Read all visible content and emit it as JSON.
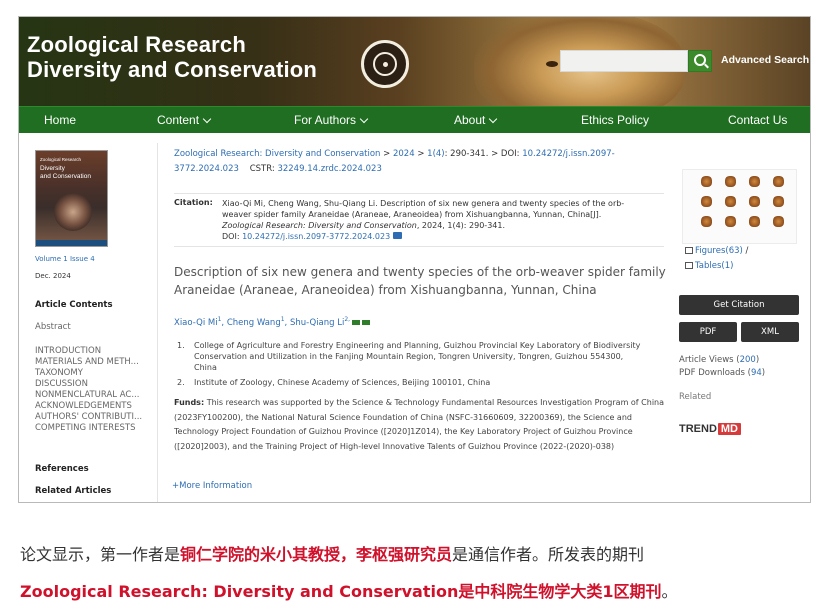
{
  "header": {
    "title_line1": "Zoological Research",
    "title_line2": "Diversity and Conservation",
    "search_placeholder": "",
    "advanced_search": "Advanced Search"
  },
  "nav": {
    "items": [
      "Home",
      "Content",
      "For Authors",
      "About",
      "Ethics Policy",
      "Contact Us"
    ]
  },
  "sidebar": {
    "cover_top": "Zoological Research",
    "cover_title1": "Diversity",
    "cover_title2": "and Conservation",
    "volume_issue": "Volume 1 Issue 4",
    "date": "Dec. 2024",
    "article_contents": "Article Contents",
    "abstract": "Abstract",
    "sections": [
      "INTRODUCTION",
      "MATERIALS AND METH...",
      "TAXONOMY",
      "DISCUSSION",
      "NONMENCLATURAL AC...",
      "ACKNOWLEDGEMENTS",
      "AUTHORS' CONTRIBUTI...",
      "COMPETING INTERESTS"
    ],
    "references": "References",
    "related_articles": "Related Articles"
  },
  "breadcrumb": {
    "journal": "Zoological Research: Diversity and Conservation",
    "sep1": " > ",
    "year": "2024",
    "sep2": " > ",
    "issue": "1(4)",
    "pages": ": 290-341. > DOI: ",
    "doi_part1": "10.24272/j.issn.2097-",
    "doi_part2": "3772.2024.023",
    "cstr_label": "CSTR: ",
    "cstr": "32249.14.zrdc.2024.023"
  },
  "citation": {
    "label": "Citation:",
    "line1": "Xiao-Qi Mi, Cheng Wang, Shu-Qiang Li. Description of six new genera and twenty species of the orb-",
    "line2": "weaver spider family Araneidae (Araneae, Araneoidea) from Xishuangbanna, Yunnan, China[J].",
    "line3_journal": "Zoological Research: Diversity and Conservation",
    "line3_rest": ", 2024, 1(4): 290-341.",
    "doi_label": "DOI: ",
    "doi": "10.24272/j.issn.2097-3772.2024.023"
  },
  "article": {
    "title_line1": "Description of six new genera and twenty species of the orb-weaver spider family",
    "title_line2": "Araneidae (Araneae, Araneoidea) from Xishuangbanna, Yunnan, China",
    "authors": [
      {
        "name": "Xiao-Qi Mi",
        "sup": "1"
      },
      {
        "name": "Cheng Wang",
        "sup": "1"
      },
      {
        "name": "Shu-Qiang Li",
        "sup": "2,"
      }
    ],
    "affiliations": [
      {
        "num": "1.",
        "text": "College of Agriculture and Forestry Engineering and Planning, Guizhou Provincial Key Laboratory of Biodiversity Conservation and Utilization in the Fanjing Mountain Region, Tongren University, Tongren, Guizhou 554300, China"
      },
      {
        "num": "2.",
        "text": "Institute of Zoology, Chinese Academy of Sciences, Beijing 100101, China"
      }
    ],
    "funds_label": "Funds:",
    "funds_text": " This research was supported by the Science & Technology Fundamental Resources Investigation Program of China (2023FY100200), the National Natural Science Foundation of China (NSFC-31660609, 32200369), the Science and Technology Project Foundation of Guizhou Province ([2020]1Z014), the Key Laboratory Project of Guizhou Province ([2020]2003), and the Training Project of High-level Innovative Talents of Guizhou Province (2022-(2020)-038)",
    "more_info": "+More Information"
  },
  "right": {
    "figures": "Figures(63)",
    "slash": " /",
    "tables": "Tables(1)",
    "get_citation": "Get Citation",
    "pdf": "PDF",
    "xml": "XML",
    "views_label": "Article Views (",
    "views": "200",
    "views_end": ")",
    "downloads_label": "PDF Downloads (",
    "downloads": "94",
    "downloads_end": ")",
    "related": "Related",
    "trend_a": "TREND",
    "trend_b": "MD"
  },
  "caption": {
    "line1_a": "论文显示，第一作者是",
    "line1_b": "铜仁学院的米小其教授，李枢强研究员",
    "line1_c": "是通信作者。所发表的期刊",
    "line2": "Zoological Research: Diversity and Conservation是中科院生物学大类1区期刊",
    "line2_end": "。"
  },
  "colors": {
    "nav_green": "#1f6e21",
    "link_blue": "#2e6db3",
    "caption_red": "#d0112b"
  }
}
